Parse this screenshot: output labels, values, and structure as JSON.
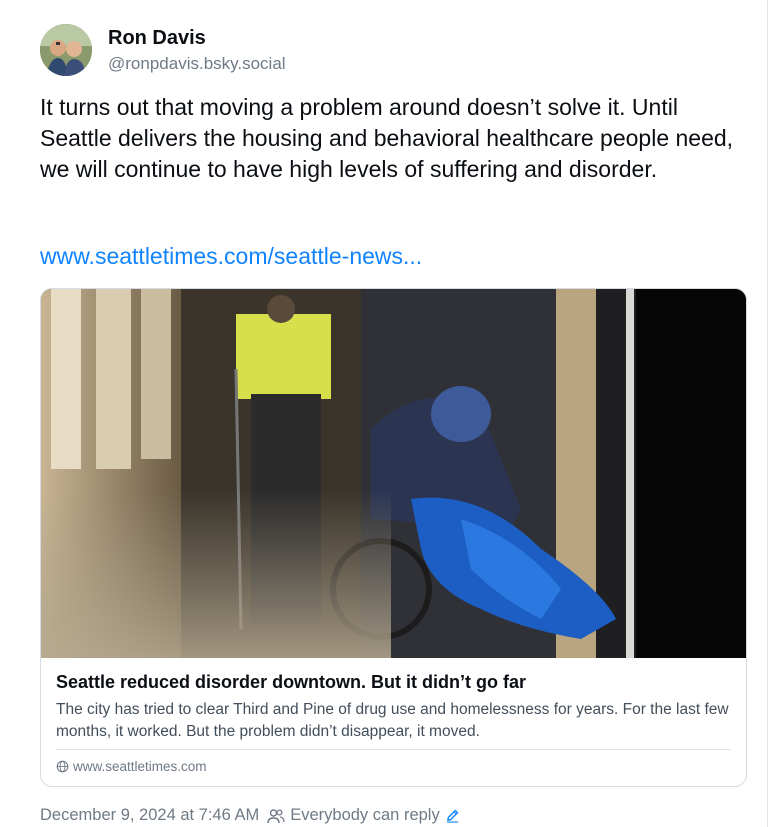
{
  "author": {
    "display_name": "Ron Davis",
    "handle": "@ronpdavis.bsky.social",
    "avatar_icon": "profile-photo"
  },
  "post": {
    "text": "It turns out that moving a problem around doesn’t solve it. Until Seattle delivers the housing and behavioral healthcare people need, we will continue to have high levels of suffering and disorder.",
    "link_text": "www.seattletimes.com/seattle-news..."
  },
  "link_card": {
    "title": "Seattle reduced disorder downtown. But it didn’t go far",
    "description": "The city has tried to clear Third and Pine of drug use and homelessness for years. For the last few months, it worked. But the problem didn’t disappear, it moved.",
    "source": "www.seattletimes.com",
    "source_icon": "globe-icon"
  },
  "meta": {
    "timestamp": "December 9, 2024 at 7:46 AM",
    "reply_setting": "Everybody can reply",
    "reply_icon": "people-icon",
    "edit_icon": "pencil-icon"
  },
  "colors": {
    "link": "#1083fe",
    "muted": "#6f7a86",
    "text": "#0b0f14",
    "border": "#d4dbe2"
  }
}
